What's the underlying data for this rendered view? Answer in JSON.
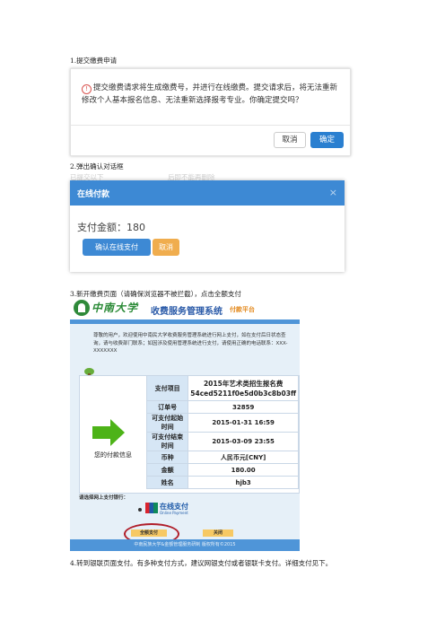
{
  "steps": {
    "s1": "1.提交缴费申请",
    "s2": "2.弹出确认对话框",
    "s3": "3.新开缴费页面（请确保浏览器不被拦截），点击全额支付",
    "s4": "4.转到银联页面支付。有多种支付方式，建议网银支付或者银联卡支付。详细支付见下。"
  },
  "dialog1": {
    "message": "提交缴费请求将生成缴费号，并进行在线缴费。提交请求后，将无法重新修改个人基本报名信息、无法重新选择报考专业。你确定提交吗？",
    "cancel": "取消",
    "confirm": "确定"
  },
  "dialog2": {
    "bg_left": "已提交以下",
    "bg_right": "后即不能再删除",
    "title": "在线付款",
    "close": "×",
    "amount_label": "支付金额：180",
    "pay_button": "确认在线支付",
    "cancel_button": "取消"
  },
  "payment_page": {
    "university": "中南大学",
    "system": "收费服务管理系统",
    "subtitle": "付款平台",
    "greeting": "尊敬的用户，欢迎使用中南民大学收费服务管理系统进行网上支付，如在支付后日状态查询，请与收费部门联系；如因涉及使用管理系统进行支付，请使用正确的电话联系：XXX-XXXXXXX",
    "side_label": "您的付款信息",
    "rows": [
      {
        "key": "支付项目",
        "value": "2015年艺术类招生报名费 54ced5211f0e5d0b3c8b03ff"
      },
      {
        "key": "订单号",
        "value": "32859"
      },
      {
        "key": "可支付起始时间",
        "value": "2015-01-31 16:59"
      },
      {
        "key": "可支付结束时间",
        "value": "2015-03-09 23:55"
      },
      {
        "key": "币种",
        "value": "人民币元[CNY]"
      },
      {
        "key": "金额",
        "value": "180.00"
      },
      {
        "key": "姓名",
        "value": "hjb3"
      }
    ],
    "bank_title": "请选择网上支付银行：",
    "online_pay": "在线支付",
    "online_pay_en": "Online Payment",
    "full_pay": "全额支付",
    "close": "关闭",
    "footer": "中南民族大学&金额管理服务研制 版权所有©2015"
  }
}
